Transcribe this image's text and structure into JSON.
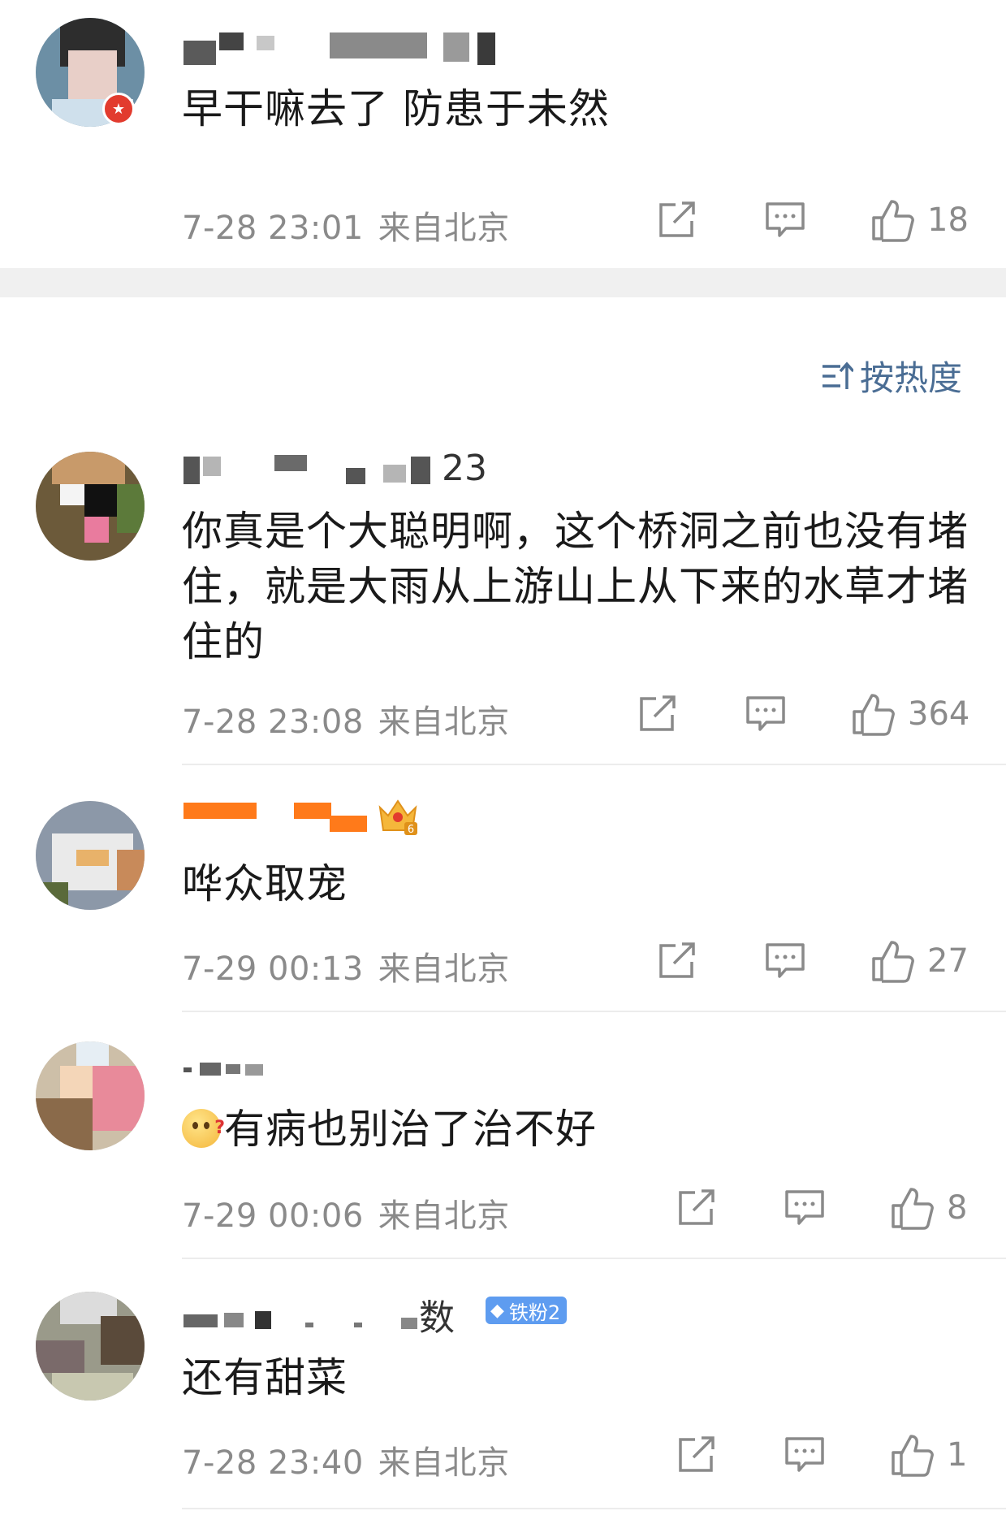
{
  "sort": {
    "label": "按热度",
    "icon": "sort-icon"
  },
  "comments": [
    {
      "username_visible": "",
      "text": "早干嘛去了 防患于未然",
      "time": "7-28 23:01",
      "location": "来自北京",
      "likes": "18",
      "badge": "verified-badge"
    },
    {
      "username_visible": "23",
      "text": "你真是个大聪明啊，这个桥洞之前也没有堵住，就是大雨从上游山上从下来的水草才堵住的",
      "time": "7-28 23:08",
      "location": "来自北京",
      "likes": "364"
    },
    {
      "username_visible": "",
      "text": "哗众取宠",
      "time": "7-29 00:13",
      "location": "来自北京",
      "likes": "27",
      "badge": "crown-6"
    },
    {
      "username_visible": "",
      "text": "有病也别治了治不好",
      "emoji": "thinking-face-emoji",
      "time": "7-29 00:06",
      "location": "来自北京",
      "likes": "8"
    },
    {
      "username_visible": "数",
      "text": "还有甜菜",
      "time": "7-28 23:40",
      "location": "来自北京",
      "likes": "1",
      "fan_badge": "铁粉2"
    }
  ],
  "colors": {
    "link": "#4a6d94",
    "meta": "#8a8a8a",
    "username_orange": "#ff7a1a",
    "fan_badge": "#5e9cf0"
  }
}
